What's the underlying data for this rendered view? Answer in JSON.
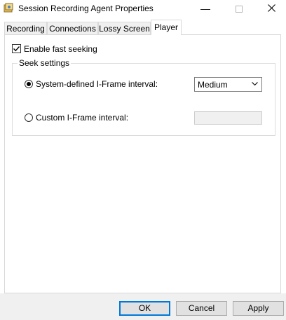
{
  "window": {
    "title": "Session Recording Agent Properties",
    "minimize_icon": "minimize-icon",
    "maximize_icon": "maximize-icon",
    "close_icon": "close-icon"
  },
  "tabs": [
    {
      "label": "Recording",
      "active": false
    },
    {
      "label": "Connections",
      "active": false
    },
    {
      "label": "Lossy Screen",
      "active": false
    },
    {
      "label": "Player",
      "active": true
    }
  ],
  "fast_seeking": {
    "label": "Enable fast seeking",
    "checked": true
  },
  "seek_settings": {
    "title": "Seek settings",
    "system_defined": {
      "label": "System-defined I-Frame interval:",
      "selected": true,
      "value": "Medium"
    },
    "custom": {
      "label": "Custom I-Frame interval:",
      "selected": false,
      "value": ""
    }
  },
  "buttons": {
    "ok": "OK",
    "cancel": "Cancel",
    "apply": "Apply"
  },
  "colors": {
    "accent": "#0078d7",
    "dialog_bg": "#f0f0f0",
    "panel_bg": "#ffffff"
  }
}
